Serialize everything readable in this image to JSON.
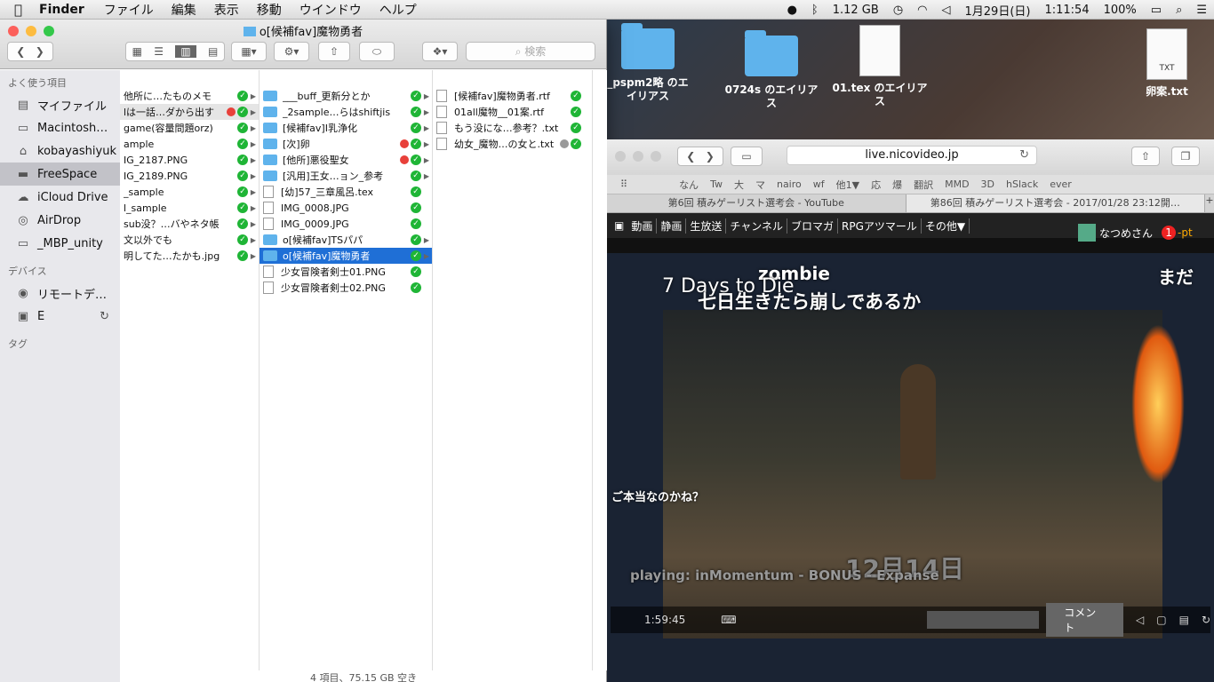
{
  "menubar": {
    "app": "Finder",
    "items": [
      "ファイル",
      "編集",
      "表示",
      "移動",
      "ウインドウ",
      "ヘルプ"
    ],
    "memory": "1.12 GB",
    "date": "1月29日(日)",
    "time": "1:11:54",
    "battery": "100%"
  },
  "finder": {
    "title": "o[候補fav]魔物勇者",
    "search_placeholder": "検索",
    "status": "4 項目、75.15 GB 空き",
    "sidebar": {
      "favorites_head": "よく使う項目",
      "favorites": [
        {
          "label": "マイファイル",
          "icon": "files-icon"
        },
        {
          "label": "Macintosh…",
          "icon": "disk-icon"
        },
        {
          "label": "kobayashiyuk",
          "icon": "home-icon"
        },
        {
          "label": "FreeSpace",
          "icon": "folder-icon",
          "selected": true
        },
        {
          "label": "iCloud Drive",
          "icon": "cloud-icon"
        },
        {
          "label": "AirDrop",
          "icon": "airdrop-icon"
        },
        {
          "label": "_MBP_unity",
          "icon": "folder-icon"
        }
      ],
      "devices_head": "デバイス",
      "devices": [
        {
          "label": "リモートデ…",
          "icon": "disc-icon"
        },
        {
          "label": "E",
          "icon": "drive-icon"
        }
      ],
      "tags_head": "タグ"
    },
    "col1": [
      {
        "n": "他所に…たものメモ"
      },
      {
        "n": "lは一話…ダから出す",
        "red": true,
        "hl": true
      },
      {
        "n": "game(容量問題orz)"
      },
      {
        "n": "ample"
      },
      {
        "n": "IG_2187.PNG"
      },
      {
        "n": "IG_2189.PNG"
      },
      {
        "n": "_sample"
      },
      {
        "n": "l_sample"
      },
      {
        "n": "sub没？…バやネタ帳"
      },
      {
        "n": "文以外でも"
      },
      {
        "n": "明してた…たかも.jpg"
      }
    ],
    "col2": [
      {
        "n": "___buff_更新分とか",
        "f": true
      },
      {
        "n": "_2sample…らはshiftjis",
        "f": true
      },
      {
        "n": "[候補fav]I乳浄化",
        "f": true
      },
      {
        "n": "[次]卵",
        "f": true,
        "red": true
      },
      {
        "n": "[他所]悪役聖女",
        "f": true,
        "red": true
      },
      {
        "n": "[汎用]王女…ョン_参考",
        "f": true
      },
      {
        "n": "[幼]57_三章風呂.tex"
      },
      {
        "n": "IMG_0008.JPG"
      },
      {
        "n": "IMG_0009.JPG"
      },
      {
        "n": "o[候補fav]TSパパ",
        "f": true
      },
      {
        "n": "o[候補fav]魔物勇者",
        "f": true,
        "sel": true
      },
      {
        "n": "少女冒険者剣士01.PNG"
      },
      {
        "n": "少女冒険者剣士02.PNG"
      }
    ],
    "col3": [
      {
        "n": "[候補fav]魔物勇者.rtf"
      },
      {
        "n": "01all魔物__01案.rtf"
      },
      {
        "n": "もう没にな…参考？.txt"
      },
      {
        "n": "幼女_魔物…の女と.txt",
        "gray": true
      }
    ]
  },
  "desktop": {
    "icons": [
      "_pspm2略 のエイリアス",
      "0724s のエイリアス",
      "01.tex のエイリアス",
      "卵案.txt"
    ]
  },
  "safari": {
    "url": "live.nicovideo.jp",
    "favorites": [
      "なん",
      "Tw",
      "大",
      "マ",
      "nairo",
      "wf",
      "他1▼",
      "応",
      "爆",
      "翻訳",
      "MMD",
      "3D",
      "hSlack",
      "ever"
    ],
    "tabs": [
      "第6回 積みゲーリスト選考会 - YouTube",
      "第86回 積みゲーリスト選考会 - 2017/01/28 23:12開…"
    ],
    "nav": [
      "動画",
      "静画",
      "生放送",
      "チャンネル",
      "ブロマガ",
      "RPGアツマール",
      "その他▼"
    ],
    "user": "なつめさん",
    "points": "-pt"
  },
  "stream": {
    "overlay_zombie": "zombie",
    "overlay_title": "7 Days to Die",
    "overlay_sub": "七日生きたら崩しであるか",
    "overlay_right": "まだ",
    "comment_q": "ご本当なのかね？",
    "playing": "playing: inMomentum - BONUS - Expanse",
    "date_overlay": "12月14日",
    "elapsed": "1:59:45",
    "comment_btn": "コメント"
  }
}
